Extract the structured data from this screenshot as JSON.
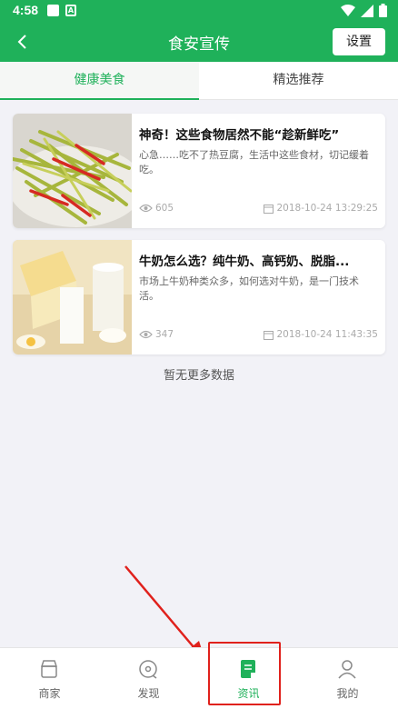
{
  "status_bar": {
    "time": "4:58",
    "icon_a": "A"
  },
  "header": {
    "title": "食安宣传",
    "settings_label": "设置"
  },
  "tabs": [
    {
      "label": "健康美食",
      "active": true
    },
    {
      "label": "精选推荐",
      "active": false
    }
  ],
  "articles": [
    {
      "title": "神奇！这些食物居然不能“趁新鲜吃”",
      "desc": "心急……吃不了热豆腐，生活中这些食材，切记缓着吃。",
      "views": "605",
      "date": "2018-10-24 13:29:25",
      "image": "green-bean-stir-fry"
    },
    {
      "title": "牛奶怎么选？纯牛奶、高钙奶、脱脂...",
      "desc": "市场上牛奶种类众多，如何选对牛奶，是一门技术活。",
      "views": "347",
      "date": "2018-10-24 11:43:35",
      "image": "milk-and-bread"
    }
  ],
  "list_footer": "暂无更多数据",
  "bottom_nav": [
    {
      "label": "商家",
      "icon": "store-icon",
      "active": false
    },
    {
      "label": "发现",
      "icon": "discover-icon",
      "active": false
    },
    {
      "label": "资讯",
      "icon": "news-icon",
      "active": true
    },
    {
      "label": "我的",
      "icon": "profile-icon",
      "active": false
    }
  ],
  "colors": {
    "brand": "#1fb15a",
    "annotation": "#e0211c",
    "background": "#f2f2f7"
  }
}
